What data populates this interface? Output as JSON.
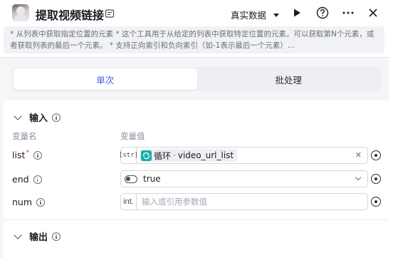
{
  "header": {
    "title": "提取视频链接",
    "mode_label": "真实数据",
    "avatar_icon": "avatar-icon",
    "edit_icon": "edit-icon",
    "run_icon": "play-icon",
    "help_icon": "help-icon",
    "more_icon": "more-icon",
    "close_icon": "close-icon"
  },
  "description": "* 从列表中获取指定位置的元素 * 这个工具用于从给定的列表中获取特定位置的元素。可以获取第N个元素，或者获取列表的最后一个元素。 * 支持正向索引和负向索引（如-1表示最后一个元素）...",
  "tabs": [
    {
      "label": "单次",
      "active": true
    },
    {
      "label": "批处理",
      "active": false
    }
  ],
  "input_section": {
    "title": "输入",
    "col_name": "变量名",
    "col_value": "变量值",
    "params": [
      {
        "name": "list",
        "required": true,
        "type_tag": "[str]",
        "ref_source": "循环",
        "ref_var": "video_url_list"
      },
      {
        "name": "end",
        "required": false,
        "value": "true"
      },
      {
        "name": "num",
        "required": false,
        "type_tag": "int.",
        "placeholder": "输入或引用参数值"
      }
    ]
  },
  "output_section": {
    "title": "输出"
  },
  "colors": {
    "accent": "#4d53e8",
    "loop_badge": "#17b0a7",
    "required": "#f54a45"
  }
}
